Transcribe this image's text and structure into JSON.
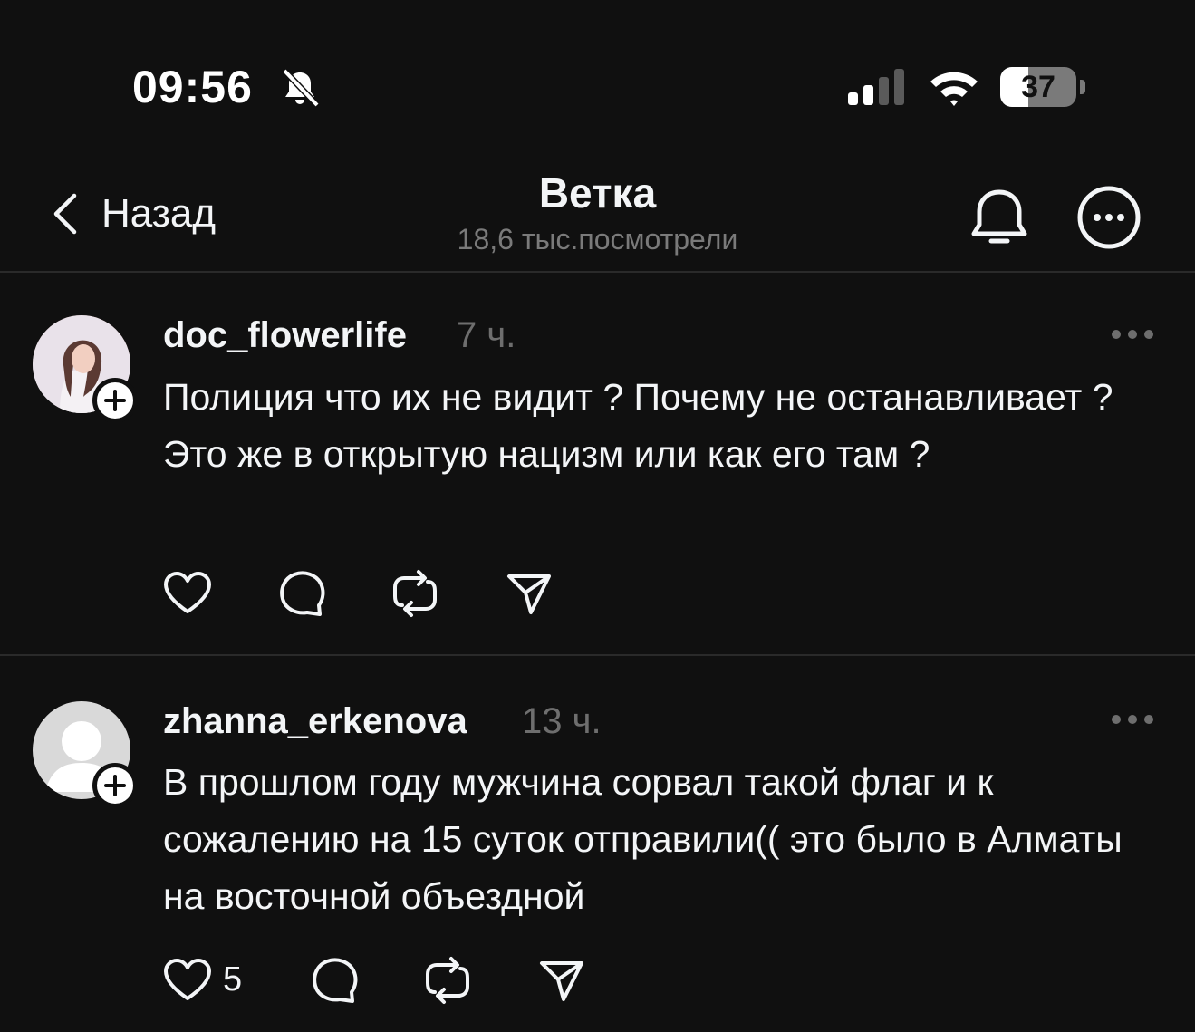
{
  "status_bar": {
    "time": "09:56",
    "battery": "37",
    "battery_level": 0.37,
    "icons": [
      "bell-slash-icon",
      "cellular-signal-icon",
      "wifi-icon",
      "battery-icon"
    ]
  },
  "header": {
    "back_label": "Назад",
    "title": "Ветка",
    "subtitle": "18,6 тыс.посмотрели",
    "icons": [
      "chevron-left-icon",
      "bell-icon",
      "more-circle-icon"
    ]
  },
  "posts": [
    {
      "username": "doc_flowerlife",
      "time": "7 ч.",
      "text": "Полиция что их не видит ? Почему не останавливает ?Это же в открытую нацизм или как его там ?",
      "likes": ""
    },
    {
      "username": "zhanna_erkenova",
      "time": "13 ч.",
      "text": "В прошлом году мужчина сорвал такой флаг и к сожалению на 15 суток отправили(( это было в Алматы на восточной объездной",
      "likes": "5"
    }
  ],
  "colors": {
    "background": "#101010",
    "text": "#f3f5f7",
    "muted": "#6e6e6e",
    "divider": "#2a2a2a"
  }
}
